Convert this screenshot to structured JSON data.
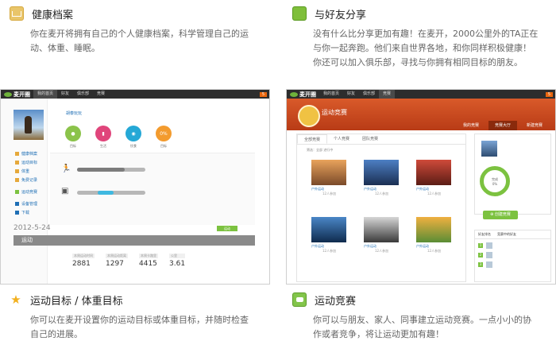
{
  "features": {
    "health": {
      "title": "健康档案",
      "desc1": "你在麦开将拥有自己的个人健康档案，科学管理自己的运",
      "desc2": "动、体重、睡眠。"
    },
    "share": {
      "title": "与好友分享",
      "desc1": "没有什么比分享更加有趣！在麦开，2000公里外的TA正在",
      "desc2": "与你一起奔跑。他们来自世界各地，和你同样积极健康！",
      "desc3": "你还可以加入俱乐部，寻找与你拥有相同目标的朋友。"
    },
    "goal": {
      "title": "运动目标 / 体重目标",
      "desc1": "你可以在麦开设置你的运动目标或体重目标，并随时检查",
      "desc2": "自己的进展。"
    },
    "contest": {
      "title": "运动竞赛",
      "desc1": "你可以与朋友、家人、同事建立运动竞赛。一点小小的协",
      "desc2": "作或者竞争，将让运动更加有趣！"
    }
  },
  "left_shot": {
    "logo": "麦开圈",
    "nav": [
      "我的首页",
      "好友",
      "俱乐部",
      "竞赛"
    ],
    "user_link": "我的档案",
    "user_line": "胡泰玩玩",
    "circle_labels": [
      "目标",
      "生活",
      "饮食",
      "目标"
    ],
    "goal_pct": "0%",
    "date": "2012-5-24",
    "green_btn": "运动",
    "section": "运动",
    "sidebar_items": [
      "健康档案",
      "运动目标",
      "体重",
      "免费记录",
      "运动竞赛",
      "设备管理",
      "下载"
    ],
    "stats": [
      {
        "label": "本周运动时间",
        "value": "2881"
      },
      {
        "label": "本周运动距离",
        "value": "1297"
      },
      {
        "label": "本周卡路里",
        "value": "4415"
      },
      {
        "label": "公里",
        "value": "3.61"
      }
    ]
  },
  "right_shot": {
    "logo": "麦开圈",
    "nav": [
      "我的首页",
      "好友",
      "俱乐部",
      "竞赛"
    ],
    "header_title": "运动竞赛",
    "header_tabs": [
      "我的竞赛",
      "竞赛大厅",
      "新建竞赛"
    ],
    "body_tabs": [
      "全部竞赛",
      "个人竞赛",
      "团队竞赛"
    ],
    "filter": "筛选：全部 进行中",
    "create_btn": "创建竞赛",
    "ring_pct": "0%",
    "ring_label": "完成",
    "thumb_caption": "户外运动",
    "thumb_sub": "12人参加",
    "list_tabs": [
      "好友排名",
      "竞赛中的好友"
    ]
  }
}
